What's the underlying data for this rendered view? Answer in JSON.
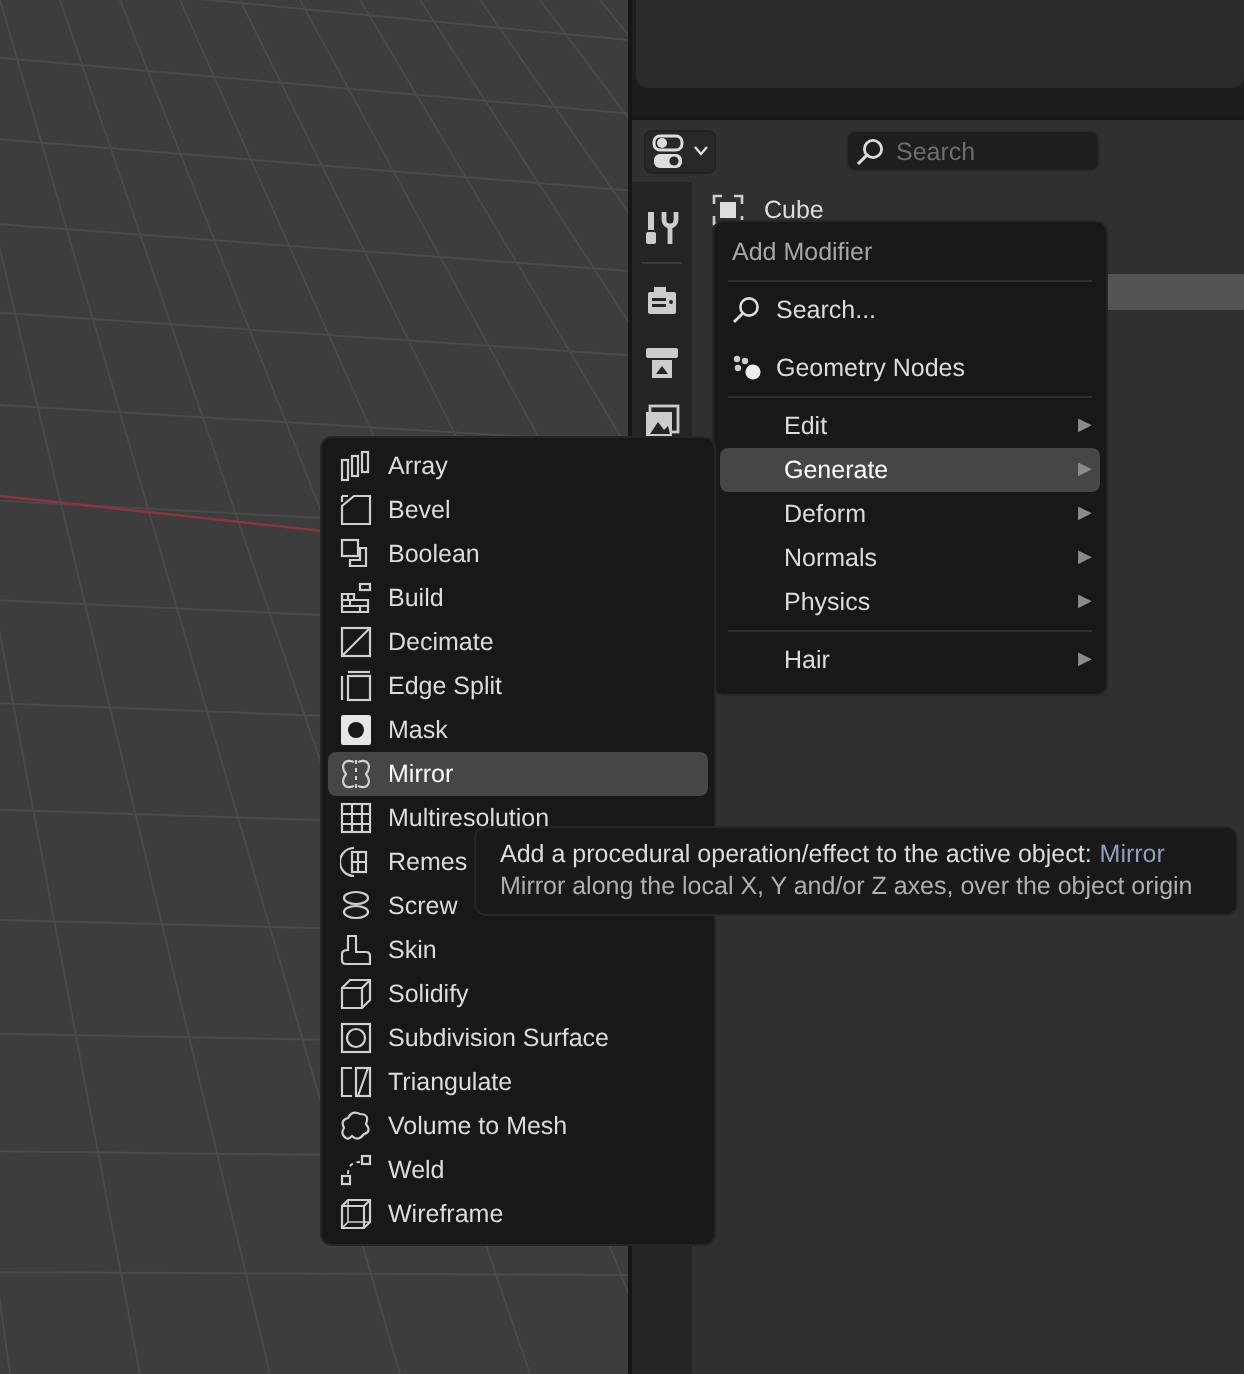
{
  "properties_editor": {
    "search": {
      "placeholder": "Search"
    },
    "object_name": "Cube"
  },
  "add_modifier_menu": {
    "title": "Add Modifier",
    "groups": [
      [
        {
          "kind": "search",
          "label": "Search...",
          "selected": false
        },
        {
          "kind": "nodes",
          "label": "Geometry Nodes",
          "selected": false
        }
      ],
      [
        {
          "kind": "submenu",
          "label": "Edit",
          "selected": false
        },
        {
          "kind": "submenu",
          "label": "Generate",
          "selected": true
        },
        {
          "kind": "submenu",
          "label": "Deform",
          "selected": false
        },
        {
          "kind": "submenu",
          "label": "Normals",
          "selected": false
        },
        {
          "kind": "submenu",
          "label": "Physics",
          "selected": false
        }
      ],
      [
        {
          "kind": "submenu",
          "label": "Hair",
          "selected": false
        }
      ]
    ],
    "arrow": "▶"
  },
  "generate_menu": {
    "items": [
      {
        "label": "Array",
        "selected": false
      },
      {
        "label": "Bevel",
        "selected": false
      },
      {
        "label": "Boolean",
        "selected": false
      },
      {
        "label": "Build",
        "selected": false
      },
      {
        "label": "Decimate",
        "selected": false
      },
      {
        "label": "Edge Split",
        "selected": false
      },
      {
        "label": "Mask",
        "selected": false
      },
      {
        "label": "Mirror",
        "selected": true
      },
      {
        "label": "Multiresolution",
        "selected": false
      },
      {
        "label": "Remes",
        "selected": false
      },
      {
        "label": "Screw",
        "selected": false
      },
      {
        "label": "Skin",
        "selected": false
      },
      {
        "label": "Solidify",
        "selected": false
      },
      {
        "label": "Subdivision Surface",
        "selected": false
      },
      {
        "label": "Triangulate",
        "selected": false
      },
      {
        "label": "Volume to Mesh",
        "selected": false
      },
      {
        "label": "Weld",
        "selected": false
      },
      {
        "label": "Wireframe",
        "selected": false
      }
    ]
  },
  "tooltip": {
    "text": "Add a procedural operation/effect to the active object:",
    "value": "Mirror",
    "description": "Mirror along the local X, Y and/or Z axes, over the object origin"
  }
}
